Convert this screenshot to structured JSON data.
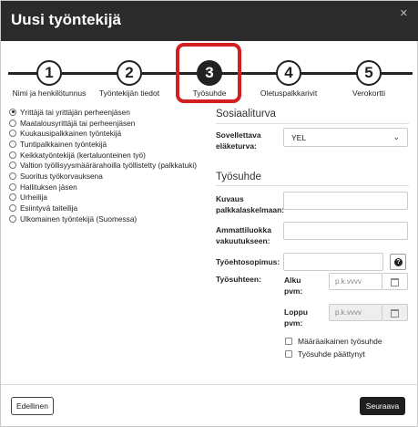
{
  "dialog": {
    "title": "Uusi työntekijä",
    "close_icon": "close-icon",
    "close_glyph": "✕"
  },
  "stepper": {
    "current_step": 3,
    "steps": [
      {
        "number": "1",
        "label": "Nimi ja henkilötunnus"
      },
      {
        "number": "2",
        "label": "Työntekijän tiedot"
      },
      {
        "number": "3",
        "label": "Työsuhde"
      },
      {
        "number": "4",
        "label": "Oletuspalkkarivit"
      },
      {
        "number": "5",
        "label": "Verokortti"
      }
    ],
    "highlight_color": "#d21f1f"
  },
  "employment_types": {
    "selected_index": 0,
    "options": [
      "Yrittäjä tai yrittäjän perheenjäsen",
      "Maatalousyrittäjä tai perheenjäsen",
      "Kuukausipalkkainen työntekijä",
      "Tuntipalkkainen työntekijä",
      "Keikkatyöntekijä (kertaluonteinen työ)",
      "Valtion työllisyysmäärärahoilla työllistetty (palkkatuki)",
      "Suoritus työkorvauksena",
      "Hallituksen jäsen",
      "Urheilija",
      "Esiintyvä taiteilija",
      "Ulkomainen työntekijä (Suomessa)"
    ]
  },
  "social_security": {
    "title": "Sosiaaliturva",
    "pension_label_line1": "Sovellettava",
    "pension_label_line2": "eläketurva:",
    "pension_value": "YEL",
    "chevron_icon": "chevron-down-icon"
  },
  "employment": {
    "title": "Työsuhde",
    "salary_calc_label_line1": "Kuvaus",
    "salary_calc_label_line2": "palkkalaskelmaan:",
    "salary_calc_value": "",
    "occupation_label_line1": "Ammattiluokka",
    "occupation_label_line2": "vakuutukseen:",
    "occupation_value": "",
    "agreement_label": "Työehtosopimus:",
    "agreement_value": "",
    "help_glyph": "?",
    "period_label": "Työsuhteen:",
    "start_label_line1": "Alku",
    "start_label_line2": "pvm:",
    "start_placeholder": "p.k.vvvv",
    "end_label_line1": "Loppu",
    "end_label_line2": "pvm:",
    "end_placeholder": "p.k.vvvv",
    "fixed_term_label": "Määräaikainen työsuhde",
    "ended_label": "Työsuhde päättynyt"
  },
  "footer": {
    "prev_label": "Edellinen",
    "next_label": "Seuraava"
  },
  "colors": {
    "header_bg": "#2b2b2b",
    "accent": "#1e1e1e",
    "highlight": "#d21f1f"
  }
}
